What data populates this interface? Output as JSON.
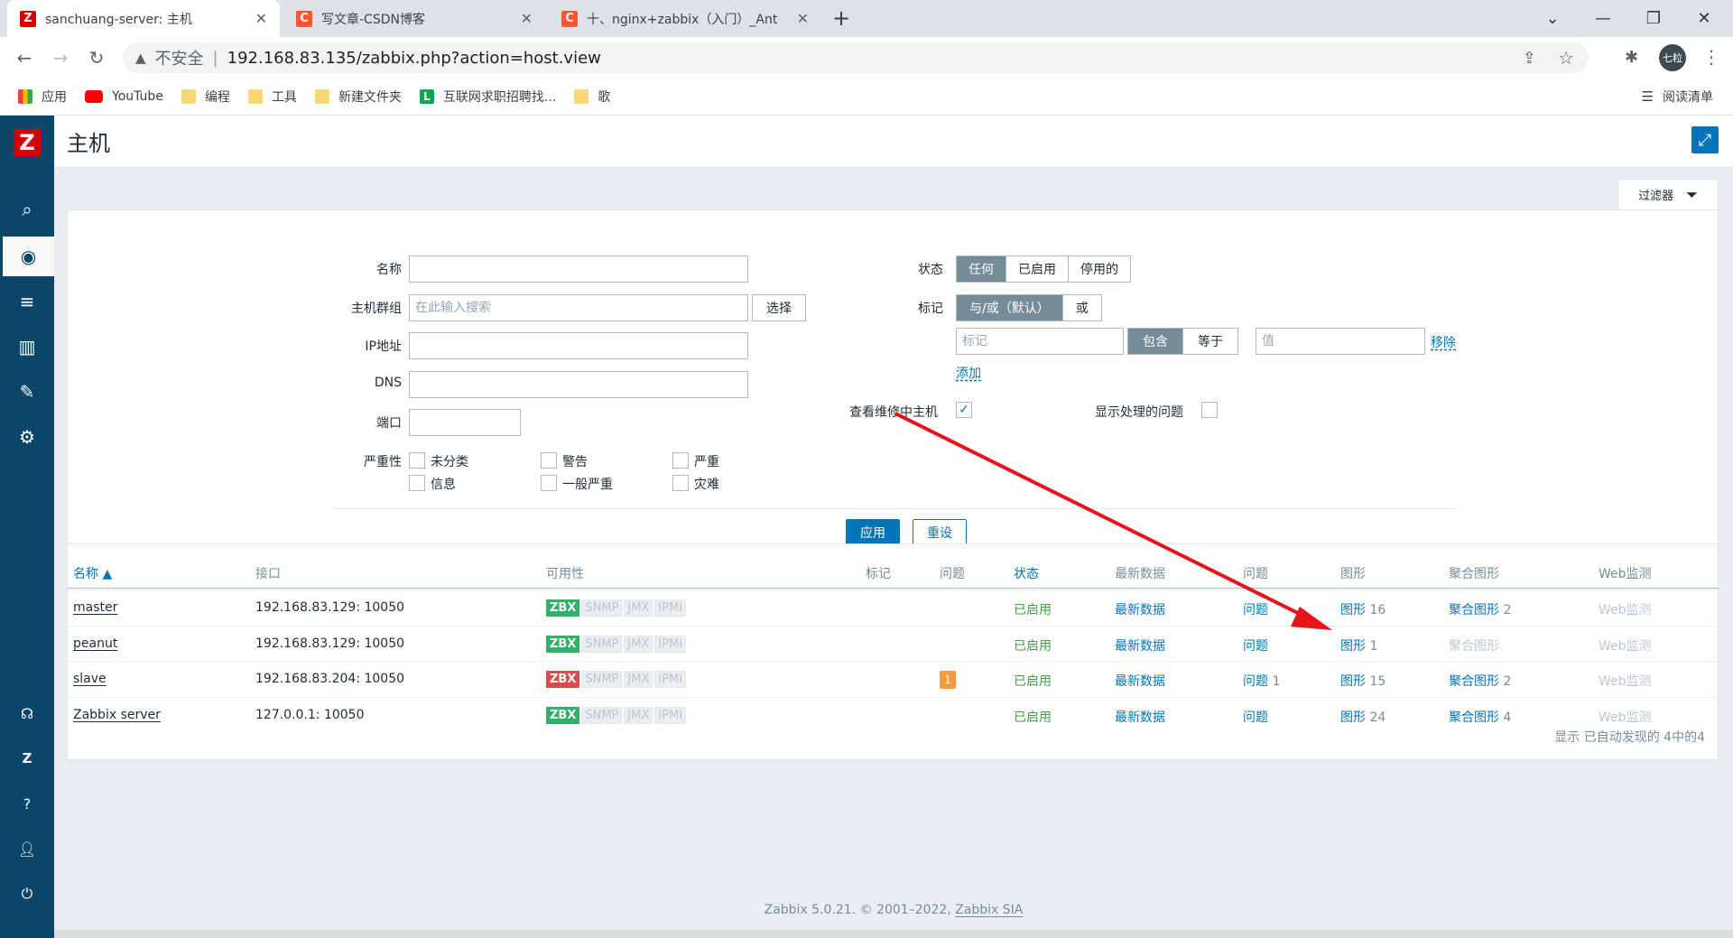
{
  "browser": {
    "tabs": [
      {
        "title": "sanchuang-server: 主机",
        "icon_color": "#d40000",
        "icon_text": "Z"
      },
      {
        "title": "写文章-CSDN博客",
        "icon_color": "#fc5531",
        "icon_text": "C"
      },
      {
        "title": "十、nginx+zabbix（入门）_Ant",
        "icon_color": "#fc5531",
        "icon_text": "C"
      }
    ],
    "security_label": "不安全",
    "url": "192.168.83.135/zabbix.php?action=host.view",
    "profile": "七粒",
    "bookmarks": [
      {
        "label": "应用",
        "icon": "apps-grid-icon"
      },
      {
        "label": "YouTube",
        "icon": "youtube-icon"
      },
      {
        "label": "编程",
        "icon": "folder-icon"
      },
      {
        "label": "工具",
        "icon": "folder-icon"
      },
      {
        "label": "新建文件夹",
        "icon": "folder-icon"
      },
      {
        "label": "互联网求职招聘找...",
        "icon": "liepin-icon"
      },
      {
        "label": "歌",
        "icon": "folder-icon"
      }
    ],
    "reading_list": "阅读清单"
  },
  "page": {
    "title": "主机",
    "filter_tab": "过滤器"
  },
  "filter": {
    "name_label": "名称",
    "hostgroup_label": "主机群组",
    "hostgroup_placeholder": "在此输入搜索",
    "select_button": "选择",
    "ip_label": "IP地址",
    "dns_label": "DNS",
    "port_label": "端口",
    "severity_label": "严重性",
    "severities": [
      "未分类",
      "信息",
      "警告",
      "一般严重",
      "严重",
      "灾难"
    ],
    "status_label": "状态",
    "status_options": [
      "任何",
      "已启用",
      "停用的"
    ],
    "tags_label": "标记",
    "tag_ops": [
      "与/或（默认）",
      "或"
    ],
    "tag_placeholder": "标记",
    "tag_match": [
      "包含",
      "等于"
    ],
    "value_placeholder": "值",
    "remove": "移除",
    "add": "添加",
    "maintenance_label": "查看维修中主机",
    "suppressed_label": "显示处理的问题",
    "apply": "应用",
    "reset": "重设"
  },
  "table": {
    "headers": [
      "名称 ▲",
      "接口",
      "可用性",
      "标记",
      "问题",
      "状态",
      "最新数据",
      "问题",
      "图形",
      "聚合图形",
      "Web监测"
    ],
    "availability_labels": [
      "ZBX",
      "SNMP",
      "JMX",
      "IPMI"
    ],
    "rows": [
      {
        "name": "master",
        "interface": "192.168.83.129: 10050",
        "zbx_ok": true,
        "problems": "",
        "status": "已启用",
        "latest": "最新数据",
        "problems_link": "问题",
        "graphs": "图形",
        "graphs_count": "16",
        "screens": "聚合图形",
        "screens_count": "2",
        "screens_active": true,
        "web": "Web监测"
      },
      {
        "name": "peanut",
        "interface": "192.168.83.129: 10050",
        "zbx_ok": true,
        "problems": "",
        "status": "已启用",
        "latest": "最新数据",
        "problems_link": "问题",
        "graphs": "图形",
        "graphs_count": "1",
        "screens": "聚合图形",
        "screens_count": "",
        "screens_active": false,
        "web": "Web监测"
      },
      {
        "name": "slave",
        "interface": "192.168.83.204: 10050",
        "zbx_ok": false,
        "problems": "1",
        "status": "已启用",
        "latest": "最新数据",
        "problems_link": "问题",
        "problems_count": "1",
        "graphs": "图形",
        "graphs_count": "15",
        "screens": "聚合图形",
        "screens_count": "2",
        "screens_active": true,
        "web": "Web监测"
      },
      {
        "name": "Zabbix server",
        "interface": "127.0.0.1: 10050",
        "zbx_ok": true,
        "problems": "",
        "status": "已启用",
        "latest": "最新数据",
        "problems_link": "问题",
        "graphs": "图形",
        "graphs_count": "24",
        "screens": "聚合图形",
        "screens_count": "4",
        "screens_active": true,
        "web": "Web监测"
      }
    ],
    "summary": "显示 已自动发现的 4中的4"
  },
  "footer": {
    "copyright": "Zabbix 5.0.21. © 2001–2022, ",
    "company": "Zabbix SIA"
  },
  "colors": {
    "sidebar": "#0a466a",
    "link": "#0275b8",
    "enabled": "#429e47",
    "annotation_arrow": "#e8141b"
  }
}
